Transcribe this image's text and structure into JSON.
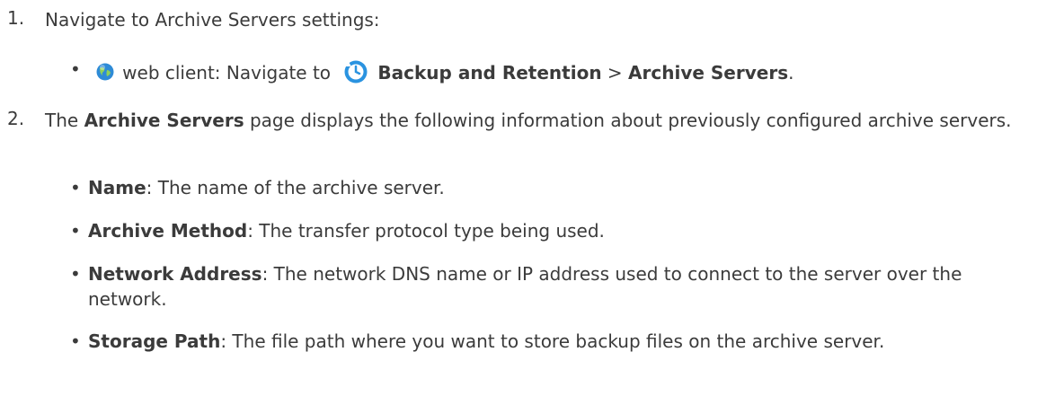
{
  "step1": {
    "number": "1.",
    "text": "Navigate to Archive Servers settings:",
    "sub": {
      "bullet": "•",
      "client": "web client: Navigate to",
      "menu1": "Backup and Retention",
      "sep": ">",
      "menu2": "Archive Servers",
      "end": "."
    }
  },
  "step2": {
    "number": "2.",
    "pre": "The",
    "page": "Archive Servers",
    "post": "page displays the following information about previously configured archive servers.",
    "items": [
      {
        "bullet": "•",
        "term": "Name",
        "desc": ": The name of the archive server."
      },
      {
        "bullet": "•",
        "term": "Archive Method",
        "desc": ": The transfer protocol type being used."
      },
      {
        "bullet": "•",
        "term": "Network Address",
        "desc": ": The network DNS name or IP address used to connect to the server over the network."
      },
      {
        "bullet": "•",
        "term": "Storage Path",
        "desc": ": The file path where you want to store backup files on the archive server."
      }
    ]
  },
  "icons": {
    "globe": "web-client-globe-icon",
    "clock": "backup-retention-clock-icon",
    "globe_color": "#2e8bd6",
    "clock_color": "#2a93e0"
  }
}
